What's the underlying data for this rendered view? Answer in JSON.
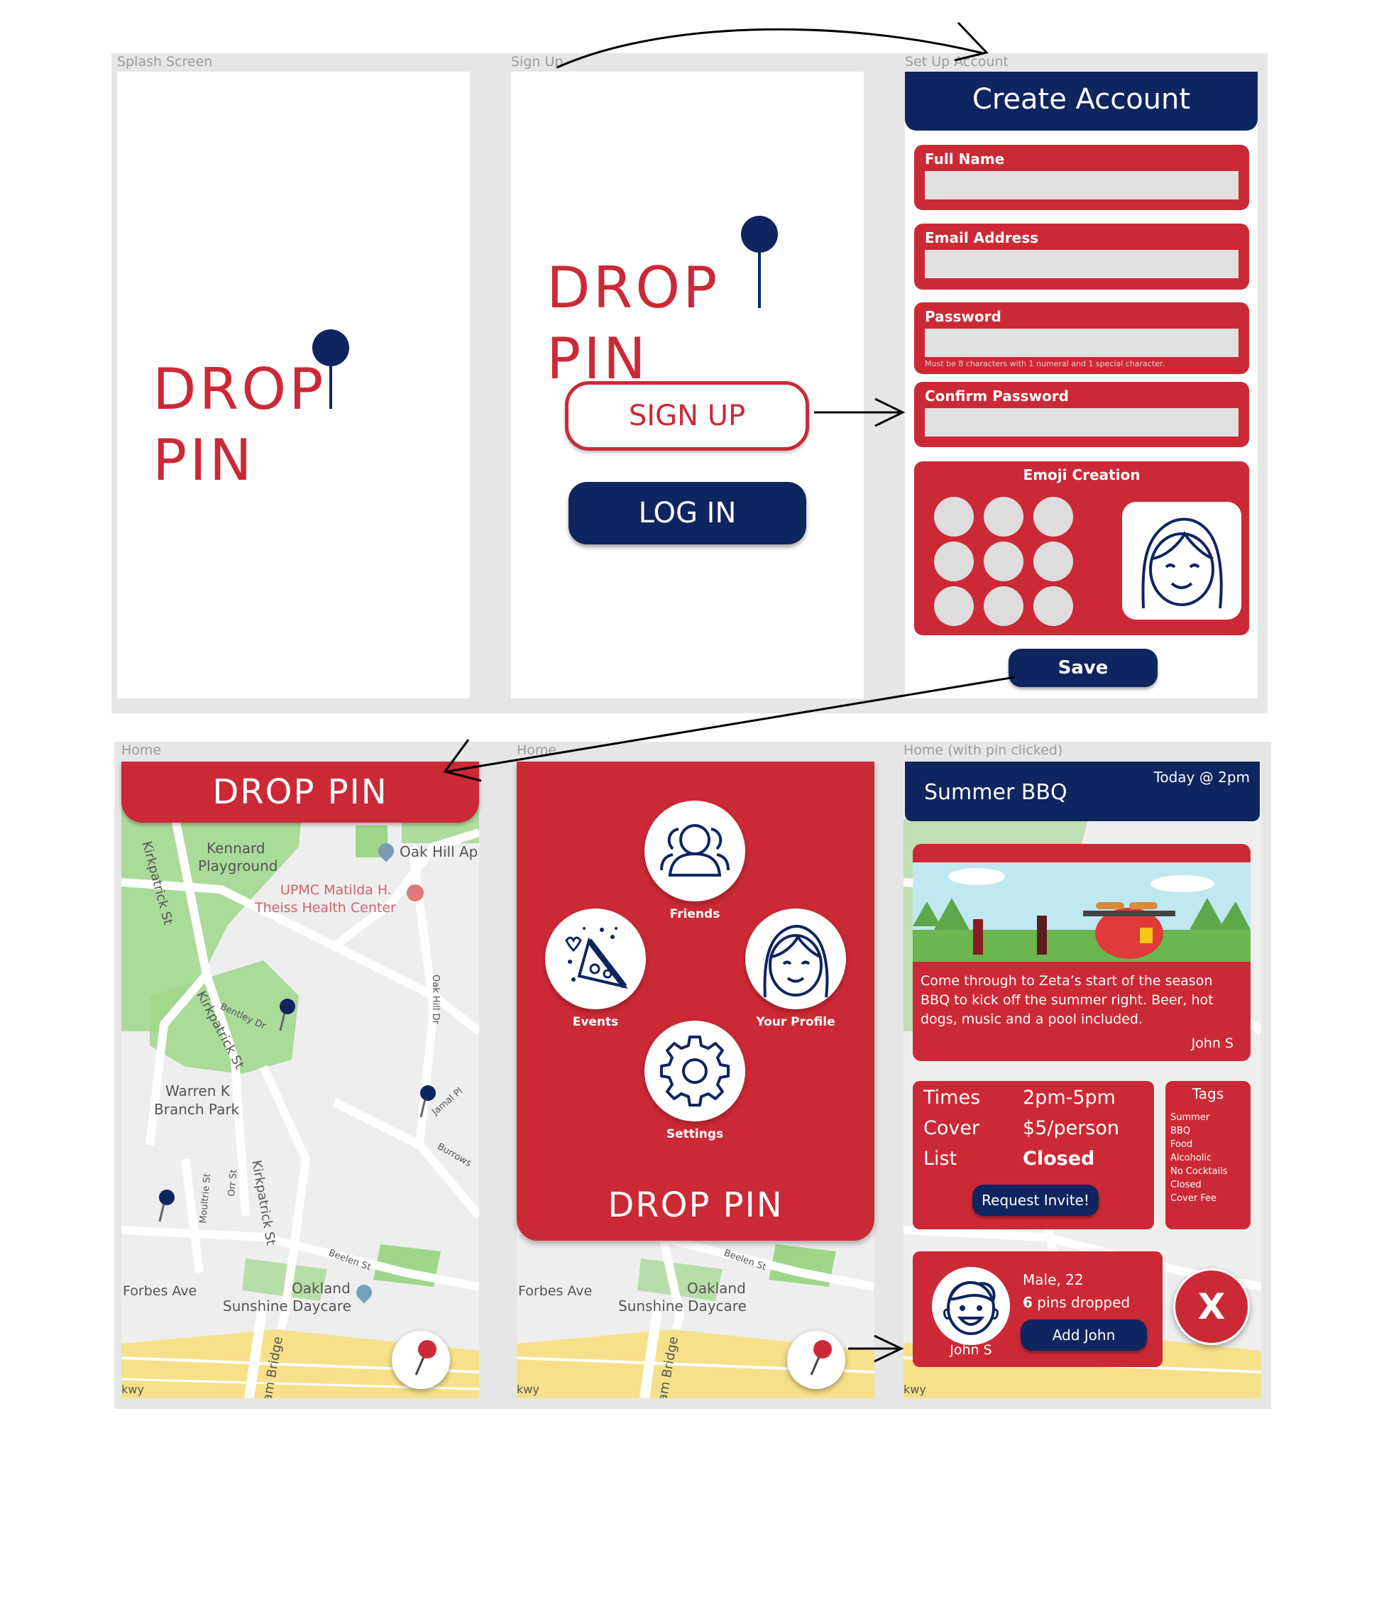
{
  "frames": {
    "splash": "Splash Screen",
    "signup": "Sign Up",
    "setup": "Set Up Account",
    "home1": "Home",
    "home2": "Home",
    "home3": "Home (with pin clicked)"
  },
  "brand": {
    "logo_text": "DROP PIN",
    "logo_left": "DROP",
    "logo_right": "PIN"
  },
  "signup": {
    "signup_label": "SIGN UP",
    "login_label": "LOG IN"
  },
  "setup": {
    "title": "Create Account",
    "full_name_label": "Full Name",
    "email_label": "Email Address",
    "password_label": "Password",
    "password_hint": "Must be 8 characters with 1 numeral and 1 special character.",
    "confirm_label": "Confirm Password",
    "emoji_label": "Emoji Creation",
    "save_label": "Save"
  },
  "map": {
    "labels": {
      "kennard": "Kennard",
      "playground": "Playground",
      "oak_hill": "Oak Hill Apa",
      "upmc1": "UPMC Matilda H.",
      "upmc2": "Theiss Health Center",
      "kirkpatrick": "Kirkpatrick St",
      "bentley": "Bentley Dr",
      "oak_hill_dr": "Oak Hill Dr",
      "warren1": "Warren K",
      "warren2": "Branch Park",
      "jamal": "Jamal Pl",
      "burrows": "Burrows",
      "moultrie": "Moultrie St",
      "orr": "Orr St",
      "beelen": "Beelen St",
      "oakland1": "Oakland",
      "oakland2": "Sunshine Daycare",
      "forbes": "Forbes Ave",
      "bridge": "am Bridge",
      "pkwy": "kwy"
    },
    "colors": {
      "park": "#9fd78a",
      "road": "#ffffff",
      "highway": "#f6e08a",
      "base": "#eeeeef"
    }
  },
  "menu": {
    "friends_label": "Friends",
    "events_label": "Events",
    "profile_label": "Your Profile",
    "settings_label": "Settings"
  },
  "event": {
    "title": "Summer BBQ",
    "when": "Today @ 2pm",
    "description": "Come through to Zeta’s start of the season BBQ to kick off the summer right. Beer, hot dogs, music and a pool included.",
    "host": "John S",
    "times_label": "Times",
    "times_value": "2pm-5pm",
    "cover_label": "Cover",
    "cover_value": "$5/person",
    "list_label": "List",
    "list_value": "Closed",
    "request_label": "Request Invite!",
    "tags_title": "Tags",
    "tags": [
      "Summer",
      "BBQ",
      "Food",
      "Alcoholic",
      "No Cocktails",
      "Closed",
      "Cover Fee"
    ],
    "profile_meta": "Male, 22",
    "pins_count": "6",
    "pins_text": "pins dropped",
    "profile_name": "John S",
    "add_label": "Add John",
    "close_label": "X"
  },
  "colors": {
    "red": "#cc2936",
    "navy": "#0f2560",
    "board": "#e6e6e6",
    "input": "#e2e0e0"
  }
}
